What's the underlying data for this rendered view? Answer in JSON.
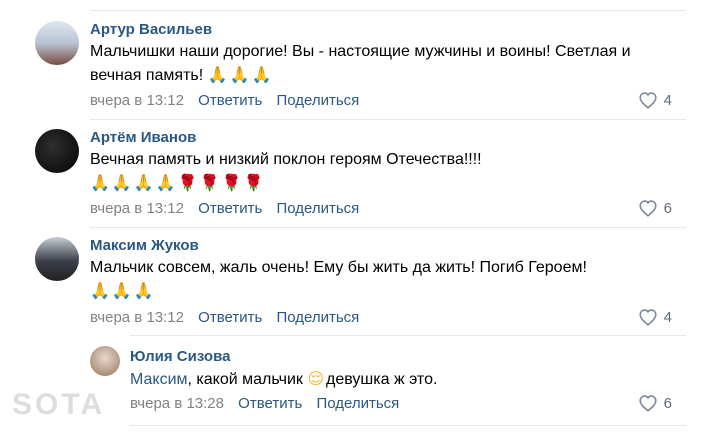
{
  "comments": [
    {
      "author": "Артур Васильев",
      "text": "Мальчишки наши дорогие! Вы - настоящие мужчины и воины! Светлая и вечная память!",
      "emoji": "🙏🙏🙏",
      "time": "вчера в 13:12",
      "reply_label": "Ответить",
      "share_label": "Поделиться",
      "likes": "4",
      "avatar_colors": [
        "#c9d3de",
        "#7a4b42"
      ]
    },
    {
      "author": "Артём Иванов",
      "text": "Вечная память и низкий поклон героям Отечества!!!!",
      "emoji": "🙏🙏🙏🙏🌹🌹🌹🌹",
      "time": "вчера в 13:12",
      "reply_label": "Ответить",
      "share_label": "Поделиться",
      "likes": "6",
      "avatar_colors": [
        "#1a1a1a",
        "#3a3a3a"
      ]
    },
    {
      "author": "Максим Жуков",
      "text": "Мальчик совсем, жаль очень! Ему бы жить да жить! Погиб Героем!",
      "emoji": "🙏🙏🙏",
      "time": "вчера в 13:12",
      "reply_label": "Ответить",
      "share_label": "Поделиться",
      "likes": "4",
      "avatar_colors": [
        "#3b3f4a",
        "#bfc3c8"
      ]
    }
  ],
  "reply": {
    "author": "Юлия Сизова",
    "mention": "Максим",
    "text": ", какой мальчик",
    "emoji": "😌",
    "text_after": "девушка ж это.",
    "time": "вчера в 13:28",
    "reply_label": "Ответить",
    "share_label": "Поделиться",
    "likes": "6",
    "avatar_colors": [
      "#d9c6b8",
      "#9a7b68"
    ]
  },
  "watermark": "SOTA"
}
